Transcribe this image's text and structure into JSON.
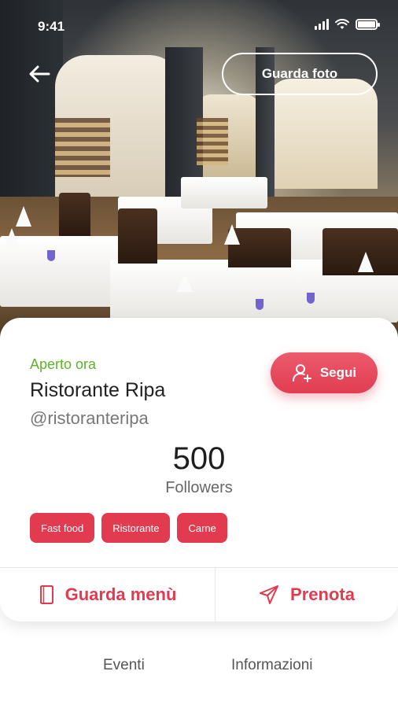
{
  "status_bar": {
    "time": "9:41"
  },
  "header": {
    "photo_button": "Guarda foto"
  },
  "restaurant": {
    "status": "Aperto ora",
    "name": "Ristorante Ripa",
    "handle": "@ristoranteripa",
    "followers_count": "500",
    "followers_label": "Followers",
    "follow_button": "Segui",
    "tags": [
      "Fast food",
      "Ristorante",
      "Carne"
    ]
  },
  "actions": {
    "menu": "Guarda menù",
    "book": "Prenota"
  },
  "tabs": {
    "events": "Eventi",
    "info": "Informazioni"
  },
  "colors": {
    "accent": "#e23a4f",
    "open": "#5cb52a"
  },
  "icons": {
    "back": "arrow-left-icon",
    "follow": "user-add-icon",
    "menu": "menu-book-icon",
    "book": "send-icon"
  }
}
